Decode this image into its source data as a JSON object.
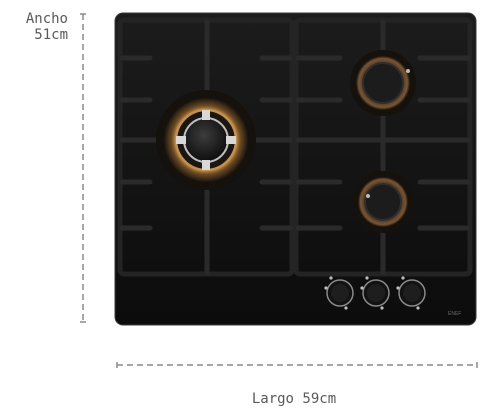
{
  "dimensions": {
    "width_label_line1": "Ancho",
    "width_label_line2": "51cm",
    "length_label": "Largo 59cm"
  },
  "product": {
    "brand_mark": "ENEF"
  },
  "colors": {
    "cooktop_glass": "#141414",
    "grate": "#262626",
    "burner_ring_glow": "#b8833c",
    "dimension_line": "#8a8a8a"
  }
}
